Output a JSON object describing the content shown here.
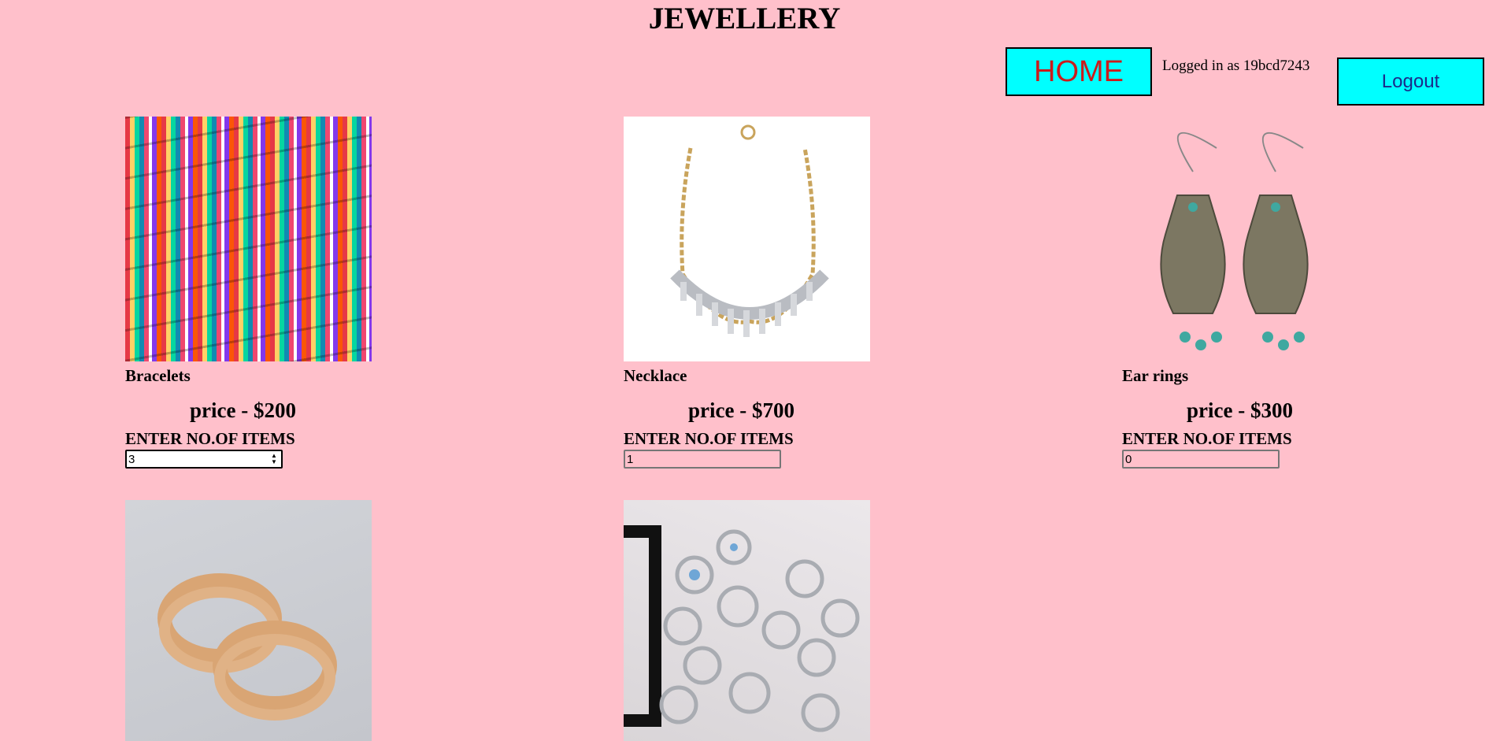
{
  "header": {
    "title": "JEWELLERY",
    "home_label": "HOME",
    "logged_in_text": "Logged in as 19bcd7243",
    "logout_label": "Logout"
  },
  "products": [
    {
      "name": "Bracelets",
      "price": "price - $200",
      "qty_label": "ENTER NO.OF ITEMS",
      "qty": "3"
    },
    {
      "name": "Necklace",
      "price": "price - $700",
      "qty_label": "ENTER NO.OF ITEMS",
      "qty": "1"
    },
    {
      "name": "Ear rings",
      "price": "price - $300",
      "qty_label": "ENTER NO.OF ITEMS",
      "qty": "0"
    }
  ],
  "colors": {
    "background": "#ffc0cb",
    "button_bg": "#00ffff",
    "home_text": "#cc1a1a",
    "logout_text": "#1a2a8a"
  }
}
